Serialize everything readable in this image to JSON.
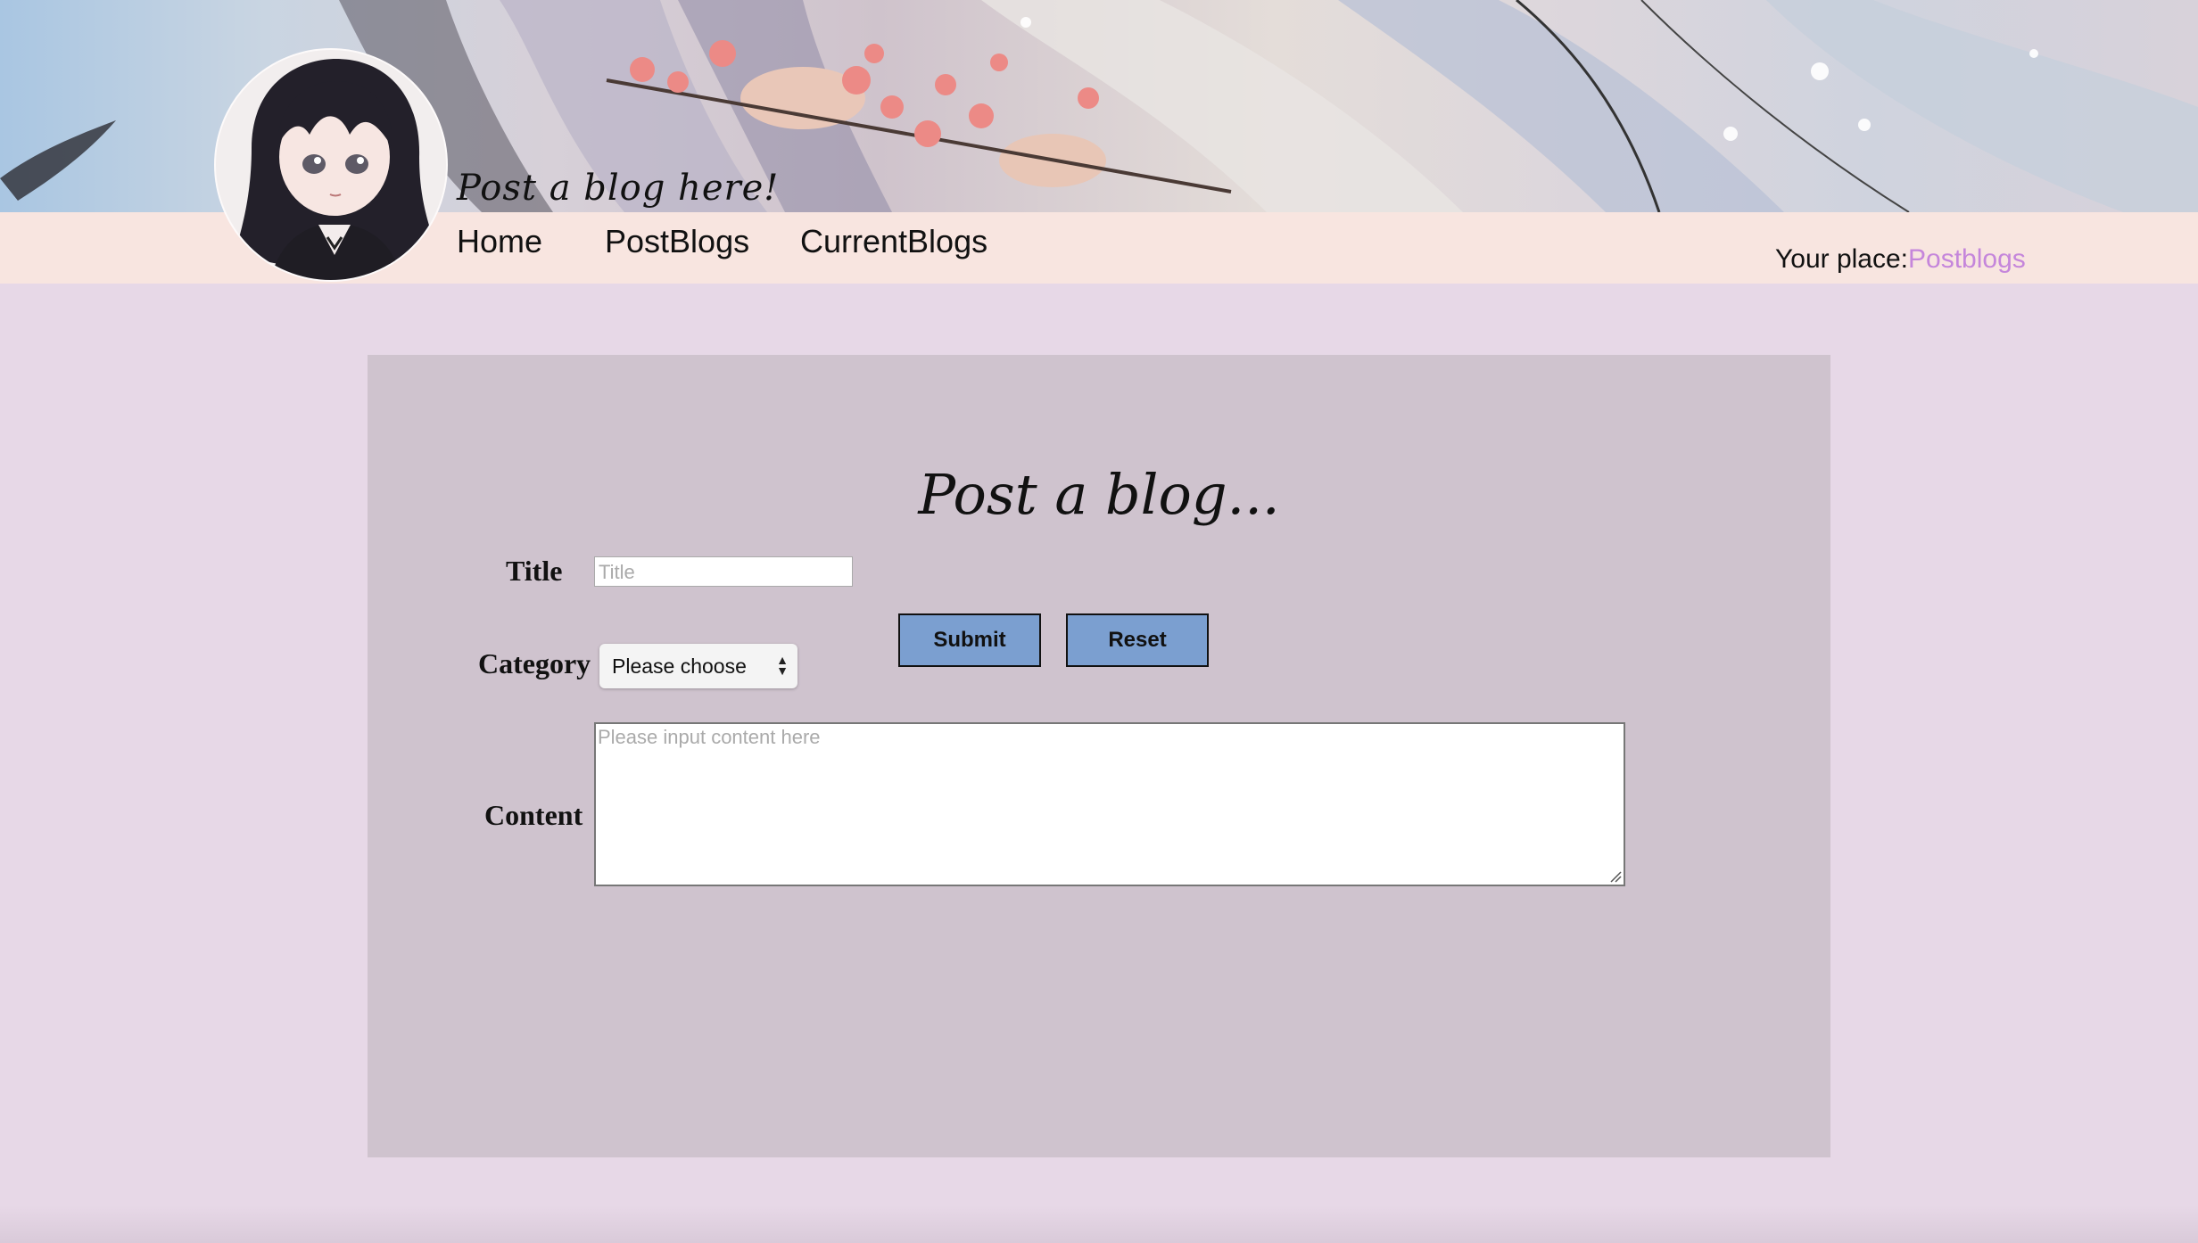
{
  "header": {
    "tagline": "Post a blog here!",
    "nav": [
      {
        "label": "Home"
      },
      {
        "label": "PostBlogs"
      },
      {
        "label": "CurrentBlogs"
      }
    ],
    "location_prefix": "Your place:",
    "location_value": "Postblogs"
  },
  "form": {
    "heading": "Post a blog...",
    "title_label": "Title",
    "title_placeholder": "Title",
    "category_label": "Category",
    "category_selected": "Please choose",
    "content_label": "Content",
    "content_placeholder": "Please input content here",
    "submit_label": "Submit",
    "reset_label": "Reset"
  },
  "colors": {
    "page_bg": "#e7d8e7",
    "nav_bg": "#f8e5e0",
    "panel_bg": "#cfc3ce",
    "button_bg": "#7b9fd0",
    "location_accent": "#c586db"
  }
}
